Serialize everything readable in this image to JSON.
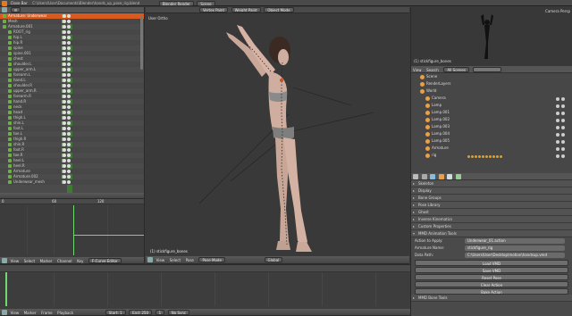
{
  "topbar": {
    "app_label": "Close Bar",
    "file_path": "C:\\Users\\User\\Documents\\Blender\\hands_up_pose_rig.blend",
    "render_engine": "Blender Render",
    "scene": "Scene"
  },
  "outliner": {
    "rows": [
      {
        "label": "Armature: Underwear",
        "selected": true
      },
      {
        "label": "Mesh"
      },
      {
        "label": "Armature.001"
      },
      {
        "label": "ROOT_rig"
      },
      {
        "label": "hip.L"
      },
      {
        "label": "hip.R"
      },
      {
        "label": "spine"
      },
      {
        "label": "spine.001"
      },
      {
        "label": "chest"
      },
      {
        "label": "shoulder.L"
      },
      {
        "label": "upper_arm.L"
      },
      {
        "label": "forearm.L"
      },
      {
        "label": "hand.L"
      },
      {
        "label": "shoulder.R"
      },
      {
        "label": "upper_arm.R"
      },
      {
        "label": "forearm.R"
      },
      {
        "label": "hand.R"
      },
      {
        "label": "neck"
      },
      {
        "label": "head"
      },
      {
        "label": "thigh.L"
      },
      {
        "label": "shin.L"
      },
      {
        "label": "foot.L"
      },
      {
        "label": "toe.L"
      },
      {
        "label": "thigh.R"
      },
      {
        "label": "shin.R"
      },
      {
        "label": "foot.R"
      },
      {
        "label": "toe.R"
      },
      {
        "label": "heel.L"
      },
      {
        "label": "heel.R"
      },
      {
        "label": "Armature"
      },
      {
        "label": "Armature.002"
      },
      {
        "label": "Underwear_mesh"
      }
    ]
  },
  "graph_editor": {
    "footer": [
      "View",
      "Select",
      "Marker",
      "Channel",
      "Key"
    ],
    "mode": "F-Curve Editor",
    "ruler_start": "0",
    "ruler_mid": "60",
    "ruler_end": "120"
  },
  "viewport": {
    "title": "User Ortho",
    "header": [
      "View",
      "Select",
      "Pose"
    ],
    "object_label": "(1) stickfigure_bones",
    "footer": [
      "View",
      "Select",
      "Pose"
    ],
    "mode": "Pose Mode",
    "pivot": "Global",
    "top_buttons": [
      "Vertex Paint",
      "Weight Paint",
      "Object Mode"
    ]
  },
  "preview": {
    "header_label": "Camera Persp",
    "camera_label": "(1) stickfigure_bones"
  },
  "right_outliner": {
    "header": [
      "View",
      "Search",
      "All Scenes"
    ],
    "rows": [
      {
        "label": "Scene"
      },
      {
        "label": "RenderLayers"
      },
      {
        "label": "World"
      },
      {
        "label": "Camera"
      },
      {
        "label": "Lamp"
      },
      {
        "label": "Lamp.001"
      },
      {
        "label": "Lamp.002"
      },
      {
        "label": "Lamp.003"
      },
      {
        "label": "Lamp.004"
      },
      {
        "label": "Lamp.005"
      },
      {
        "label": "Armature"
      },
      {
        "label": "rig"
      }
    ]
  },
  "properties": {
    "panels": [
      {
        "label": "Skeleton",
        "open": false
      },
      {
        "label": "Display",
        "open": false
      },
      {
        "label": "Bone Groups",
        "open": false
      },
      {
        "label": "Pose Library",
        "open": false
      },
      {
        "label": "Ghost",
        "open": false
      },
      {
        "label": "Inverse Kinematics",
        "open": false
      },
      {
        "label": "Custom Properties",
        "open": false
      },
      {
        "label": "MMD Animation Tools",
        "open": true
      }
    ],
    "fields": [
      {
        "label": "Action to Apply:",
        "value": "Underwear_01.action"
      },
      {
        "label": "Armature Name:",
        "value": "stickfigure_rig"
      },
      {
        "label": "Data Path:",
        "value": "C:\\Users\\User\\Desktop\\motion\\handsup.vmd"
      }
    ],
    "buttons": [
      "Load VMD",
      "Save VMD",
      "Reset Pose",
      "Clear Action",
      "Bake Action"
    ],
    "bottom_panel": "MMD Bone Tools"
  },
  "timeline": {
    "footer": [
      "View",
      "Marker",
      "Frame",
      "Playback"
    ],
    "start_label": "Start: 1",
    "end_label": "End: 250",
    "frame_label": "1",
    "sync": "No Sync"
  },
  "colors": {
    "selection": "#d85a1e",
    "frame_cursor": "#6fd86f",
    "panel_bg": "#4a4a4a"
  }
}
